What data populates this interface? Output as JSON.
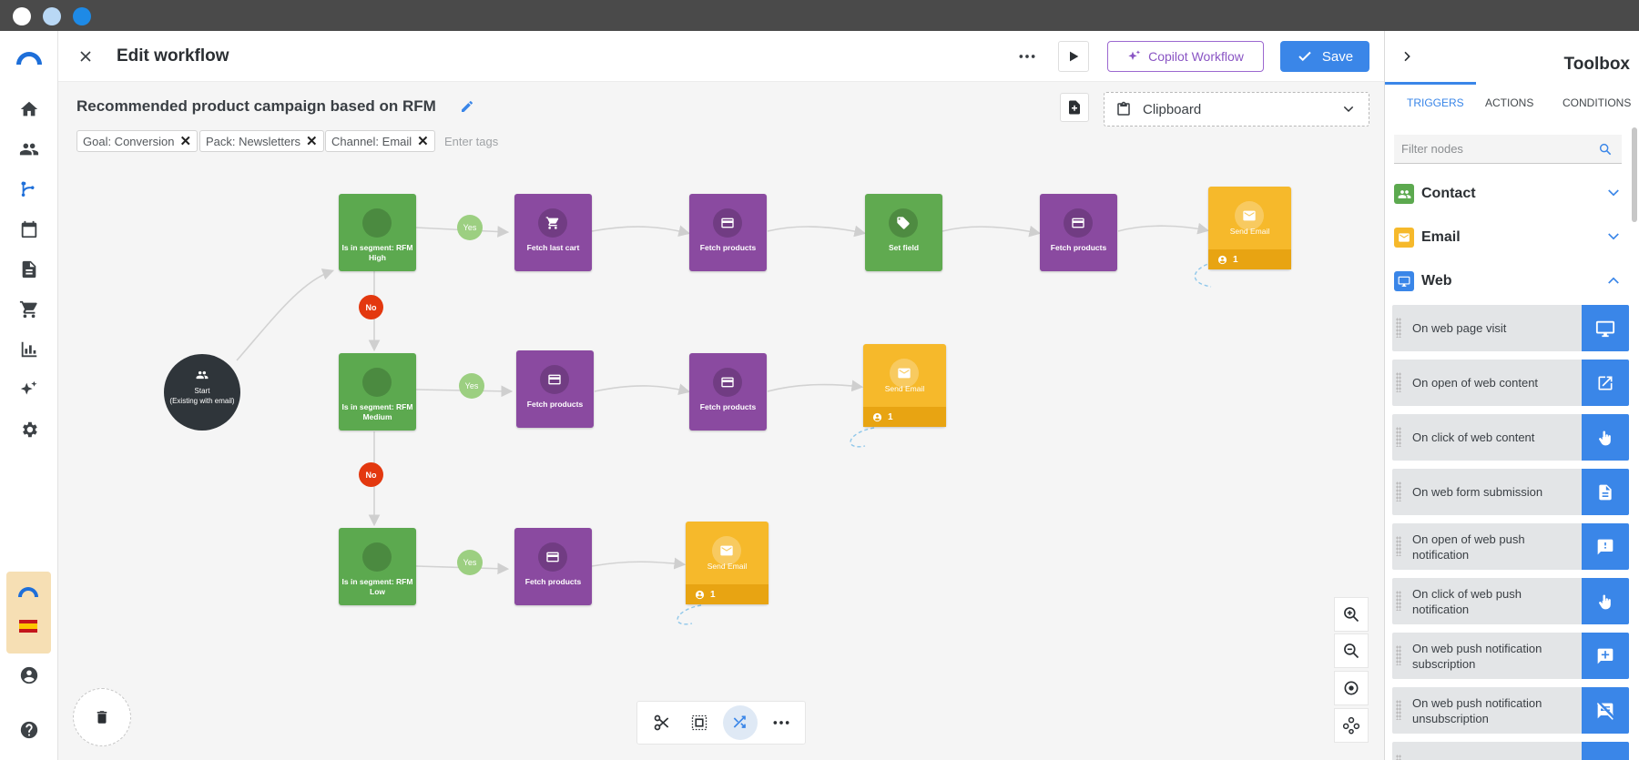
{
  "header": {
    "title": "Edit workflow",
    "copilot_label": "Copilot Workflow",
    "save_label": "Save"
  },
  "workflow": {
    "name": "Recommended product campaign based on RFM",
    "tags": [
      "Goal: Conversion",
      "Pack: Newsletters",
      "Channel: Email"
    ],
    "tag_placeholder": "Enter tags",
    "clipboard_label": "Clipboard"
  },
  "canvas": {
    "start_label": "Start",
    "start_sub": "(Existing with email)",
    "yes": "Yes",
    "no": "No",
    "nodes": {
      "seg_high": "Is in segment: RFM High",
      "seg_medium": "Is in segment: RFM Medium",
      "seg_low": "Is in segment: RFM Low",
      "fetch_cart": "Fetch last cart",
      "fetch_products": "Fetch products",
      "set_field": "Set field",
      "send_email": "Send Email",
      "count": "1"
    }
  },
  "toolbox": {
    "title": "Toolbox",
    "tabs": [
      "TRIGGERS",
      "ACTIONS",
      "CONDITIONS"
    ],
    "filter_placeholder": "Filter nodes",
    "sections": [
      "Contact",
      "Email",
      "Web"
    ],
    "items": [
      {
        "label": "On web page visit",
        "icon": "monitor-icon"
      },
      {
        "label": "On open of web content",
        "icon": "open-external-icon"
      },
      {
        "label": "On click of web content",
        "icon": "pointer-hand-icon"
      },
      {
        "label": "On web form submission",
        "icon": "document-icon"
      },
      {
        "label": "On open of web push notification",
        "icon": "message-alert-icon"
      },
      {
        "label": "On click of web push notification",
        "icon": "pointer-hand-icon"
      },
      {
        "label": "On web push notification subscription",
        "icon": "message-plus-icon"
      },
      {
        "label": "On web push notification unsubscription",
        "icon": "message-off-icon"
      }
    ]
  },
  "colors": {
    "accent": "#3a86e8",
    "condition": "#5ca94f",
    "action": "#8a4aa0",
    "email": "#f6b92b",
    "no": "#e3380f"
  }
}
